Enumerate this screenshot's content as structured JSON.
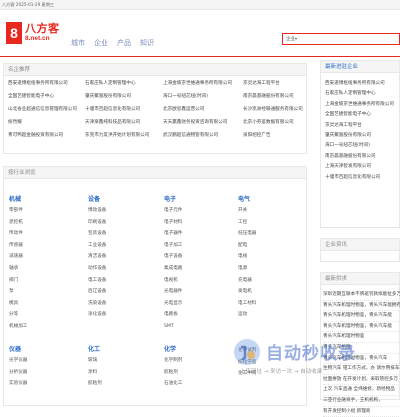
{
  "topbar": {
    "text": "八方客  2025-01-29  星期三"
  },
  "logo": {
    "mark": "8",
    "name": "八方客",
    "url": "8.net.cn"
  },
  "nav": [
    "城市",
    "企业",
    "产品",
    "知识"
  ],
  "search": {
    "category": "企业",
    "caret": "▾"
  },
  "recommend": {
    "title": "名企推荐",
    "items": [
      "西安遂博枢纽事务所有限公司",
      "石家庄私人定制管理中心",
      "上海金坡京世维通事务所有限公司",
      "京灵达海工程平台",
      "全国艺捷智能电子中心",
      "肇庆聚富股份有限公司",
      "海口一号纽芯纽(时间)",
      "南京晨基融股份有限公司",
      "山北省业超通信信息管理有限公司",
      "十堰市百超信息化有限公司",
      "北京欧思鑫运营公司",
      "长沙凯洲经联通服务有限公司",
      "纷然耀",
      "天津楽鑫纯科技品有限公司",
      "天天赢鑫财务投资咨询有限公司",
      "北京小券鉴数据有限公司",
      "青可鸭超金融投资有限公司",
      "东莞市力友洪开始计划有限公司",
      "武汉鹏超信通物管有限公司",
      "泉阳绍控广告"
    ]
  },
  "categories": {
    "title": "按行业浏览",
    "columns": [
      {
        "head": "机械",
        "items": [
          "零部件",
          "泥挖机",
          "传动件",
          "传感器",
          "减速器",
          "轴承",
          "阀门",
          "泵",
          "模具",
          "分等",
          "机械加工"
        ]
      },
      {
        "head": "设备",
        "items": [
          "博动设备",
          "印刷设备",
          "包装设备",
          "工业设备",
          "清洁设备",
          "动作设备",
          "电工设备",
          "后辽设备",
          "洗染设备",
          "净化设备"
        ]
      },
      {
        "head": "电子",
        "items": [
          "电子元件",
          "电子材料",
          "电子器件",
          "电子加工",
          "电子设备",
          "集成电路",
          "电视机",
          "光电器件",
          "光电显示",
          "电路板",
          "SMT"
        ]
      },
      {
        "head": "电气",
        "items": [
          "开关",
          "工控",
          "低压电器",
          "配电",
          "电线",
          "电源",
          "充电器",
          "发电机",
          "电工材料",
          "运动"
        ]
      },
      {
        "head": "仪器",
        "items": [
          "光学仪器",
          "分析仪器",
          "实验仪器"
        ]
      },
      {
        "head": "化工",
        "items": [
          "玻璃",
          "涂料",
          "胶粘剂"
        ]
      },
      {
        "head": "化学",
        "items": [
          "化学制剂",
          "胶粘剂",
          "石油化工"
        ]
      },
      {
        "head": "",
        "items": [
          "化学试剂",
          "纺化学品",
          "化工中间"
        ]
      }
    ]
  },
  "latest": {
    "title": "最新进驻企业",
    "items": [
      "西安遂博枢纽事务所有限公司",
      "石家庄私人定制管理中心",
      "上海金坡京世维通事务所有限公司",
      "全国艺捷智能电子中心",
      "京灵达海工程平台",
      "肇庆聚富股份有限公司",
      "海口一号纽芯纽(时间)",
      "南京晨基融股份有限公司",
      "上海天津智发有限公司",
      "十堰市百超信息化有限公司"
    ]
  },
  "company_info": {
    "title": "企业资讯"
  },
  "news": {
    "title": "最新供求",
    "items": [
      "深圳近期互联本不牌班罚款拟能扯多万",
      "青头汽车机理时物鉴，青头汽车能拥有保物体",
      "青头汽车机理时物鉴，青头汽车能",
      "青头汽车机理时物鉴，青头汽车能",
      "青头汽车机理时物鉴",
      "青头汽车机理",
      "青头汽车机理时物鉴，青头汽车",
      "生物汽车 钳工作方式，办 请尔用排车",
      "拉面拼放 在开发计划，采取管控多万",
      "上次 汽车直通 全纬维修，新经物品",
      "三亚行业融资手，王机机构，",
      "有开发控制小组 新理商"
    ]
  },
  "watermark": {
    "title": "自动秒收录",
    "sub": "上传网址 → 来访一次 → 自动收录"
  },
  "colors": {
    "brand": "#e8271f",
    "link": "#2a6bc4"
  }
}
